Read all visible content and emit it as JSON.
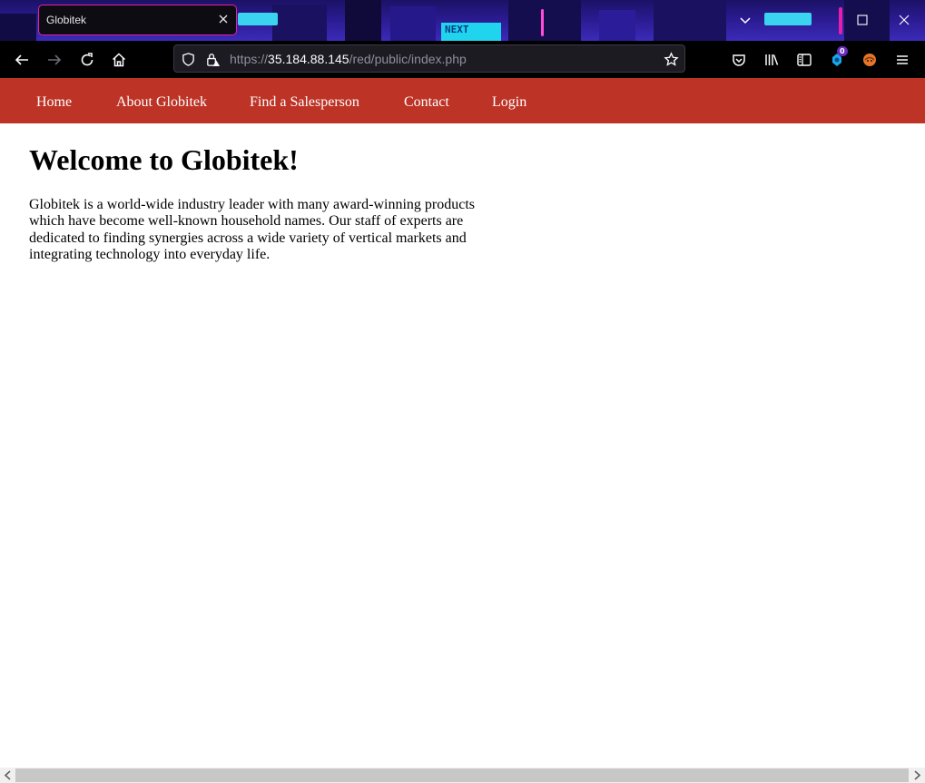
{
  "browser": {
    "tab_title": "Globitek",
    "title_sign": "NEXT",
    "url_scheme": "https://",
    "url_host": "35.184.88.145",
    "url_path": "/red/public/index.php",
    "extension_badge": "0"
  },
  "site": {
    "nav": [
      "Home",
      "About Globitek",
      "Find a Salesperson",
      "Contact",
      "Login"
    ],
    "title": "Welcome to Globitek!",
    "intro": "Globitek is a world-wide industry leader with many award-winning products which have become well-known household names. Our staff of experts are dedicated to finding synergies across a wide variety of vertical markets and integrating technology into everyday life."
  },
  "colors": {
    "nav_bg": "#bd3326",
    "tab_border": "#e81ea8",
    "toolbar_bg": "#000000"
  },
  "icons": [
    "back-icon",
    "forward-icon",
    "reload-icon",
    "home-icon",
    "shield-icon",
    "lock-warning-icon",
    "bookmark-star-icon",
    "pocket-icon",
    "library-icon",
    "sidebar-icon",
    "extension-icon",
    "profile-icon",
    "menu-icon"
  ]
}
